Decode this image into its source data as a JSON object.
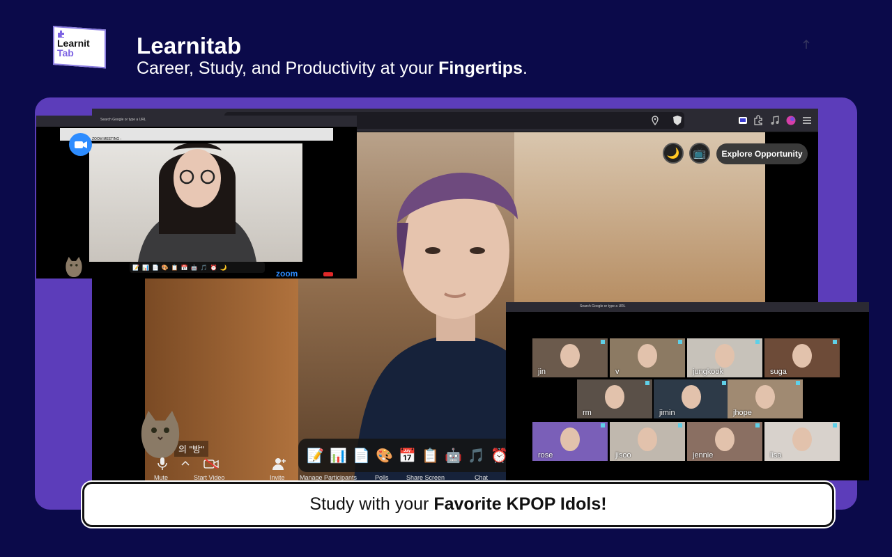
{
  "brand": {
    "logo_line1": "Learnit",
    "logo_line2": "Tab",
    "title": "Learnitab",
    "subtitle_prefix": "Career, Study, and Productivity at your ",
    "subtitle_bold": "Fingertips",
    "subtitle_suffix": "."
  },
  "main_window": {
    "explore_label": "Explore Opportunity",
    "caption_korean": "의 \"방\"",
    "zoom_controls": [
      "Mute",
      "Start Video",
      "Invite",
      "Manage Participants",
      "Polls",
      "Share Screen",
      "Chat"
    ],
    "dock_icons": [
      "notepad-icon",
      "chart-icon",
      "document-icon",
      "palette-icon",
      "calendar-icon",
      "clipboard-icon",
      "robot-icon",
      "music-icon",
      "alarm-icon"
    ]
  },
  "left_window": {
    "url_placeholder": "Search Google or type a URL",
    "meeting_header": "ZOOM MEETING :",
    "zoom_logo": "zoom"
  },
  "right_window": {
    "url_placeholder": "Search Google or type a URL",
    "tiles": [
      "jin",
      "v",
      "jungkook",
      "suga",
      "rm",
      "jimin",
      "jhope",
      "rose",
      "jisoo",
      "jennie",
      "lisa"
    ]
  },
  "caption": {
    "prefix": "Study with your",
    "bold": "Favorite KPOP Idols!"
  },
  "colors": {
    "background": "#0b0a4a",
    "panel": "#5c3dba",
    "zoom_blue": "#2d8cff"
  }
}
